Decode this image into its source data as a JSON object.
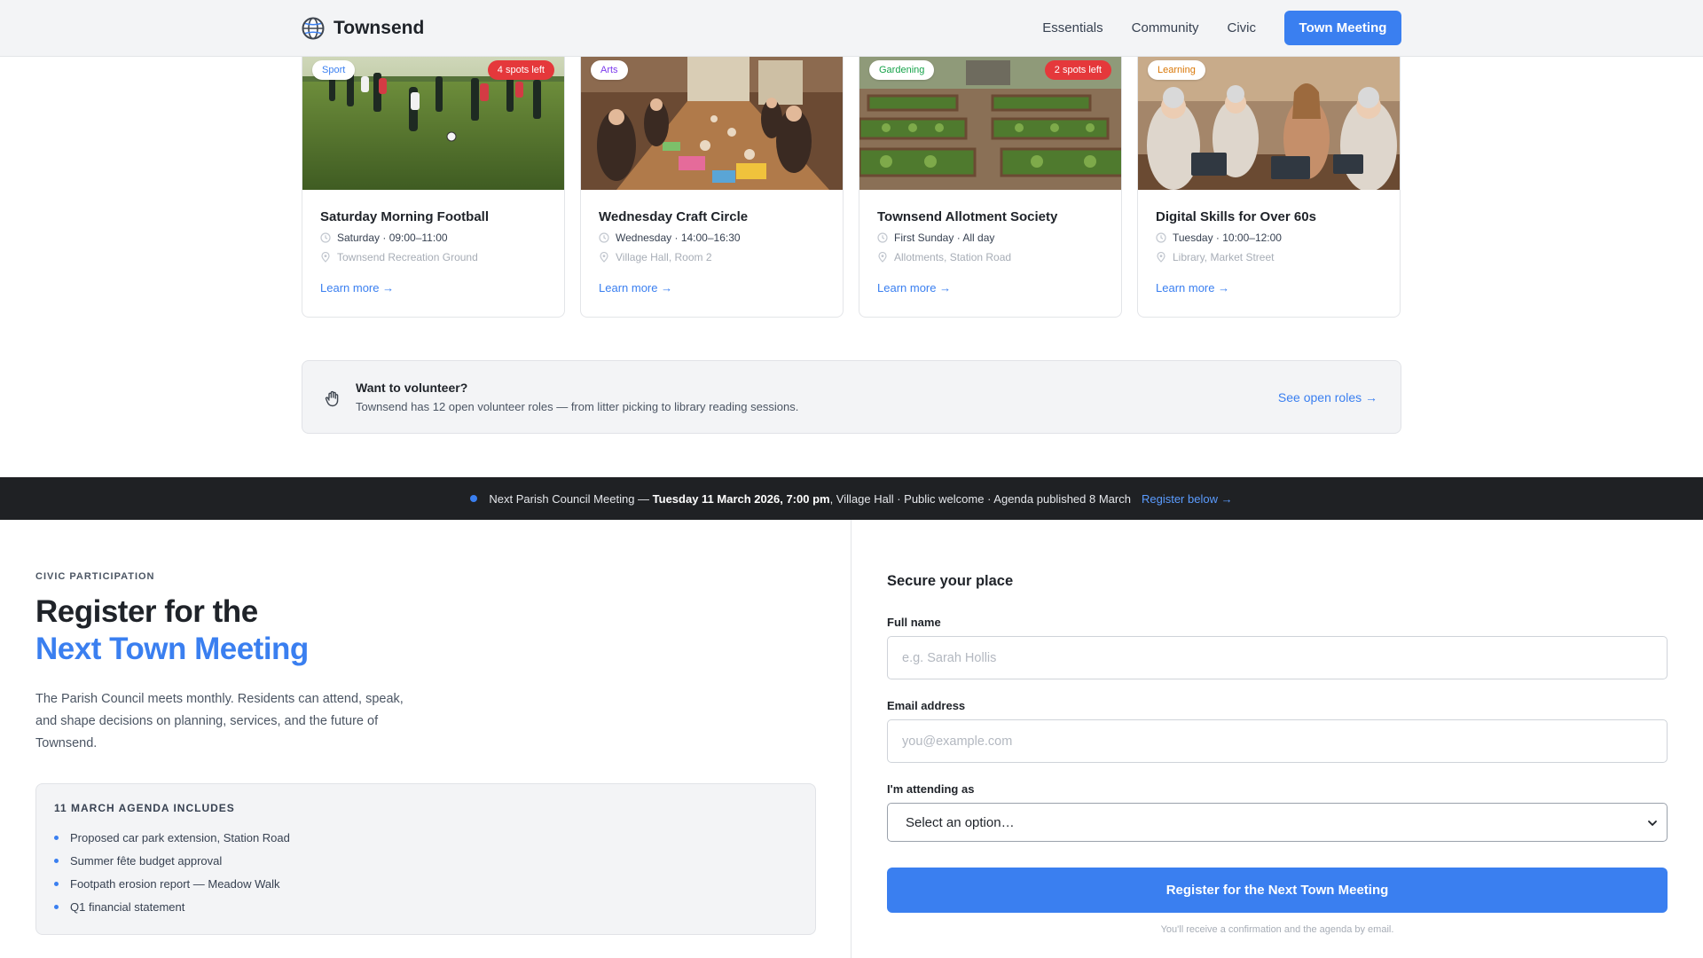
{
  "header": {
    "brand": "Townsend",
    "nav": [
      "Essentials",
      "Community",
      "Civic"
    ],
    "cta": "Town Meeting"
  },
  "cards": [
    {
      "tag": "Sport",
      "tag_color": "#3a7ff0",
      "spots": "4 spots left",
      "title": "Saturday Morning Football",
      "time": "Saturday · 09:00–11:00",
      "place": "Townsend Recreation Ground",
      "link": "Learn more →"
    },
    {
      "tag": "Arts",
      "tag_color": "#7c3aed",
      "spots": "",
      "title": "Wednesday Craft Circle",
      "time": "Wednesday · 14:00–16:30",
      "place": "Village Hall, Room 2",
      "link": "Learn more →"
    },
    {
      "tag": "Gardening",
      "tag_color": "#16a34a",
      "spots": "2 spots left",
      "title": "Townsend Allotment Society",
      "time": "First Sunday · All day",
      "place": "Allotments, Station Road",
      "link": "Learn more →"
    },
    {
      "tag": "Learning",
      "tag_color": "#d97706",
      "spots": "",
      "title": "Digital Skills for Over 60s",
      "time": "Tuesday · 10:00–12:00",
      "place": "Library, Market Street",
      "link": "Learn more →"
    }
  ],
  "volunteer": {
    "title": "Want to volunteer?",
    "description": "Townsend has 12 open volunteer roles — from litter picking to library reading sessions.",
    "link": "See open roles →"
  },
  "banner": {
    "prefix": "Next Parish Council Meeting — ",
    "datetime": "Tuesday 11 March 2026, 7:00 pm",
    "suffix": ", Village Hall · Public welcome · Agenda published 8 March",
    "link": "Register below →"
  },
  "register": {
    "eyebrow": "CIVIC PARTICIPATION",
    "heading_line1": "Register for the",
    "heading_line2": "Next Town Meeting",
    "intro": "The Parish Council meets monthly. Residents can attend, speak, and shape decisions on planning, services, and the future of Townsend.",
    "agenda_title": "11 MARCH AGENDA INCLUDES",
    "agenda_items": [
      "Proposed car park extension, Station Road",
      "Summer fête budget approval",
      "Footpath erosion report — Meadow Walk",
      "Q1 financial statement"
    ]
  },
  "form": {
    "title": "Secure your place",
    "name_label": "Full name",
    "name_placeholder": "e.g. Sarah Hollis",
    "email_label": "Email address",
    "email_placeholder": "you@example.com",
    "attending_label": "I'm attending as",
    "attending_value": "Select an option…",
    "submit": "Register for the Next Town Meeting",
    "footnote": "You'll receive a confirmation and the agenda by email."
  }
}
